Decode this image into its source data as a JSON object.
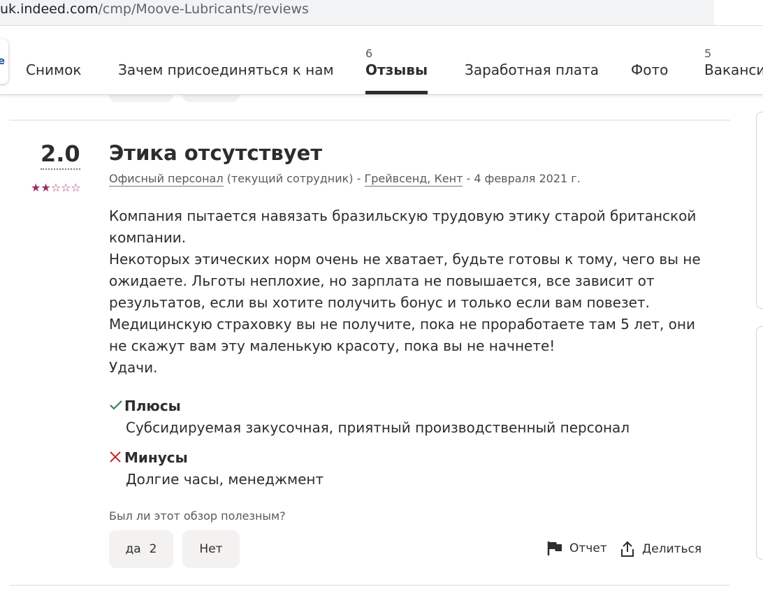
{
  "browser": {
    "url_domain": "uk.indeed.com",
    "url_path": "/cmp/Moove-Lubricants/reviews"
  },
  "tabs": [
    {
      "label": "Снимок",
      "count": ""
    },
    {
      "label": "Зачем присоединяться к нам",
      "count": ""
    },
    {
      "label": "Отзывы",
      "count": "6",
      "active": true
    },
    {
      "label": "Заработная плата",
      "count": ""
    },
    {
      "label": "Фото",
      "count": ""
    },
    {
      "label": "Вакансии",
      "count": "5"
    }
  ],
  "review": {
    "rating": "2.0",
    "stars_filled": 2,
    "stars_total": 5,
    "title": "Этика отсутствует",
    "job_title": "Офисный персонал",
    "employee_status": "(текущий сотрудник)",
    "separator": "-",
    "location": "Грейвсенд, Кент",
    "date": "- 4 февраля 2021 г.",
    "body_lines": [
      "Компания пытается навязать бразильскую трудовую этику старой британской компании.",
      "Некоторых этических норм очень не хватает, будьте готовы к тому, чего вы не ожидаете. Льготы неплохие, но зарплата не повышается, все зависит от результатов, если вы хотите получить бонус и только если вам повезет.",
      "Медицинскую страховку вы не получите, пока не проработаете там 5 лет, они не скажут вам эту маленькую красоту, пока вы не начнете!",
      "Удачи."
    ],
    "pros_label": "Плюсы",
    "pros_text": "Субсидируемая закусочная, приятный производственный персонал",
    "cons_label": "Минусы",
    "cons_text": "Долгие часы, менеджмент",
    "helpful_question": "Был ли этот обзор полезным?",
    "yes_label": "да",
    "yes_count": "2",
    "no_label": "Нет",
    "report_label": "Отчет",
    "share_label": "Делиться"
  },
  "colors": {
    "star": "#9d2b6b",
    "pros_check": "#2d7d46",
    "cons_x": "#c62828"
  },
  "icons": [
    "check-icon",
    "x-icon",
    "flag-icon",
    "share-icon",
    "star-icon"
  ]
}
